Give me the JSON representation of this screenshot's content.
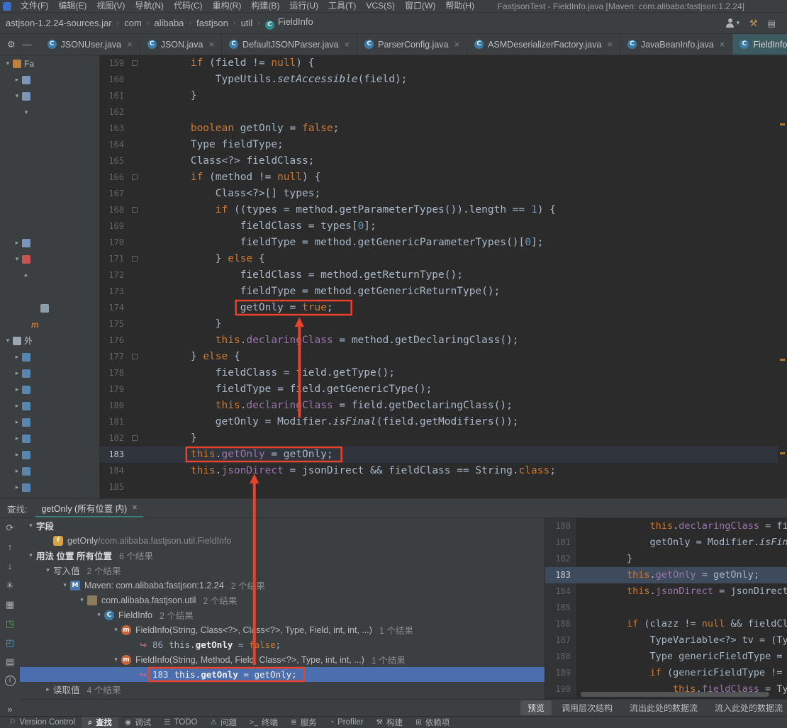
{
  "window_title": "FastjsonTest - FieldInfo.java [Maven: com.alibaba:fastjson:1.2.24]",
  "menu": {
    "items": [
      "文件(F)",
      "编辑(E)",
      "视图(V)",
      "导航(N)",
      "代码(C)",
      "重构(R)",
      "构建(B)",
      "运行(U)",
      "工具(T)",
      "VCS(S)",
      "窗口(W)",
      "帮助(H)"
    ]
  },
  "breadcrumb": {
    "items": [
      "astjson-1.2.24-sources.jar",
      "com",
      "alibaba",
      "fastjson",
      "util"
    ],
    "class_item": "FieldInfo"
  },
  "tabbar_tools": {
    "settings_glyph": "⚙",
    "hide_glyph": "—"
  },
  "editor_tabs": [
    {
      "label": "JSONUser.java",
      "close": true
    },
    {
      "label": "JSON.java",
      "close": true
    },
    {
      "label": "DefaultJSONParser.java",
      "close": true
    },
    {
      "label": "ParserConfig.java",
      "close": true
    },
    {
      "label": "ASMDeserializerFactory.java",
      "close": true
    },
    {
      "label": "JavaBeanInfo.java",
      "close": true
    },
    {
      "label": "FieldInfo",
      "close": false,
      "active": true
    }
  ],
  "project_panel": {
    "rows": [
      {
        "chev": "v",
        "icon": "proj",
        "label": "Fa",
        "ind": 0
      },
      {
        "chev": ">",
        "icon": "folder",
        "ind": 1
      },
      {
        "chev": "v",
        "icon": "folder",
        "ind": 1
      },
      {
        "chev": "v",
        "ind": 2
      },
      {
        "ind": 0
      },
      {
        "ind": 0
      },
      {
        "ind": 0
      },
      {
        "ind": 0
      },
      {
        "ind": 0
      },
      {
        "ind": 0
      },
      {
        "ind": 0
      },
      {
        "chev": ">",
        "icon": "folder",
        "ind": 1
      },
      {
        "chev": "v",
        "icon": "folderRed",
        "ind": 1
      },
      {
        "chev": ">",
        "ind": 2
      },
      {
        "ind": 0
      },
      {
        "icon": "file",
        "ind": 3
      },
      {
        "label": "m",
        "cls": "m",
        "ind": 2
      },
      {
        "chev": "v",
        "icon": "ext",
        "label": "外",
        "ind": 0
      },
      {
        "chev": ">",
        "icon": "lib",
        "ind": 1
      },
      {
        "chev": ">",
        "icon": "lib",
        "ind": 1
      },
      {
        "chev": ">",
        "icon": "lib",
        "ind": 1
      },
      {
        "chev": ">",
        "icon": "lib",
        "ind": 1
      },
      {
        "chev": ">",
        "icon": "lib",
        "ind": 1
      },
      {
        "chev": ">",
        "icon": "lib",
        "ind": 1
      },
      {
        "chev": ">",
        "icon": "lib",
        "ind": 1
      },
      {
        "chev": ">",
        "icon": "lib",
        "ind": 1
      },
      {
        "chev": ">",
        "icon": "lib",
        "ind": 1
      }
    ]
  },
  "editor": {
    "current_line": 183,
    "scroll_marks": [
      96,
      428,
      560,
      634
    ],
    "lines": [
      {
        "n": 159,
        "i": 8,
        "f": true,
        "s": [
          [
            "if",
            "k"
          ],
          [
            " (field != ",
            ""
          ],
          [
            "null",
            "k"
          ],
          [
            ") {",
            ""
          ]
        ]
      },
      {
        "n": 160,
        "i": 12,
        "s": [
          [
            "TypeUtils.",
            ""
          ],
          [
            "setAccessible",
            "s"
          ],
          [
            "(field);",
            ""
          ]
        ]
      },
      {
        "n": 161,
        "i": 8,
        "s": [
          [
            "}",
            ""
          ]
        ]
      },
      {
        "n": 162,
        "i": 0,
        "s": []
      },
      {
        "n": 163,
        "i": 8,
        "s": [
          [
            "boolean",
            "k"
          ],
          [
            " getOnly = ",
            ""
          ],
          [
            "false",
            "k"
          ],
          [
            ";",
            ""
          ]
        ]
      },
      {
        "n": 164,
        "i": 8,
        "s": [
          [
            "Type fieldType;",
            ""
          ]
        ]
      },
      {
        "n": 165,
        "i": 8,
        "s": [
          [
            "Class<?> fieldClass;",
            ""
          ]
        ]
      },
      {
        "n": 166,
        "i": 8,
        "f": true,
        "s": [
          [
            "if",
            "k"
          ],
          [
            " (method != ",
            ""
          ],
          [
            "null",
            "k"
          ],
          [
            ") {",
            ""
          ]
        ]
      },
      {
        "n": 167,
        "i": 12,
        "s": [
          [
            "Class<?>[] types;",
            ""
          ]
        ]
      },
      {
        "n": 168,
        "i": 12,
        "f": true,
        "s": [
          [
            "if",
            "k"
          ],
          [
            " ((types = method.getParameterTypes()).length == ",
            ""
          ],
          [
            "1",
            "n"
          ],
          [
            ") {",
            ""
          ]
        ]
      },
      {
        "n": 169,
        "i": 16,
        "s": [
          [
            "fieldClass = types[",
            ""
          ],
          [
            "0",
            "n"
          ],
          [
            "];",
            ""
          ]
        ]
      },
      {
        "n": 170,
        "i": 16,
        "s": [
          [
            "fieldType = method.getGenericParameterTypes()[",
            ""
          ],
          [
            "0",
            "n"
          ],
          [
            "];",
            ""
          ]
        ]
      },
      {
        "n": 171,
        "i": 12,
        "f": true,
        "s": [
          [
            "} ",
            ""
          ],
          [
            "else",
            "k"
          ],
          [
            " {",
            ""
          ]
        ]
      },
      {
        "n": 172,
        "i": 16,
        "s": [
          [
            "fieldClass = method.getReturnType();",
            ""
          ]
        ]
      },
      {
        "n": 173,
        "i": 16,
        "s": [
          [
            "fieldType = method.getGenericReturnType();",
            ""
          ]
        ]
      },
      {
        "n": 174,
        "i": 16,
        "hl": "hl-174",
        "s": [
          [
            "getOnly = ",
            ""
          ],
          [
            "true",
            "k"
          ],
          [
            ";",
            ""
          ]
        ]
      },
      {
        "n": 175,
        "i": 12,
        "s": [
          [
            "}",
            ""
          ]
        ]
      },
      {
        "n": 176,
        "i": 12,
        "s": [
          [
            "this",
            "k"
          ],
          [
            ".",
            ""
          ],
          [
            "declaringClass",
            "f2"
          ],
          [
            " = method.getDeclaringClass();",
            ""
          ]
        ]
      },
      {
        "n": 177,
        "i": 8,
        "f": true,
        "s": [
          [
            "} ",
            ""
          ],
          [
            "else",
            "k"
          ],
          [
            " {",
            ""
          ]
        ]
      },
      {
        "n": 178,
        "i": 12,
        "s": [
          [
            "fieldClass = field.getType();",
            ""
          ]
        ]
      },
      {
        "n": 179,
        "i": 12,
        "s": [
          [
            "fieldType = field.getGenericType();",
            ""
          ]
        ]
      },
      {
        "n": 180,
        "i": 12,
        "s": [
          [
            "this",
            "k"
          ],
          [
            ".",
            ""
          ],
          [
            "declaringClass",
            "f2"
          ],
          [
            " = field.getDeclaringClass();",
            ""
          ]
        ]
      },
      {
        "n": 181,
        "i": 12,
        "s": [
          [
            "getOnly = Modifier.",
            ""
          ],
          [
            "isFinal",
            "s"
          ],
          [
            "(field.getModifiers());",
            ""
          ]
        ]
      },
      {
        "n": 182,
        "i": 8,
        "f": true,
        "s": [
          [
            "}",
            ""
          ]
        ]
      },
      {
        "n": 183,
        "i": 8,
        "cur": true,
        "hl": "hl-183",
        "s": [
          [
            "this",
            "k"
          ],
          [
            ".",
            ""
          ],
          [
            "getOnly",
            "f2"
          ],
          [
            " = getOnly;",
            ""
          ]
        ]
      },
      {
        "n": 184,
        "i": 8,
        "s": [
          [
            "this",
            "k"
          ],
          [
            ".",
            ""
          ],
          [
            "jsonDirect",
            "f2"
          ],
          [
            " = jsonDirect && fieldClass == String.",
            ""
          ],
          [
            "class",
            "k"
          ],
          [
            ";",
            ""
          ]
        ]
      },
      {
        "n": 185,
        "i": 0,
        "s": []
      }
    ]
  },
  "find_panel": {
    "label": "查找:",
    "tab": {
      "title": "getOnly (所有位置 内)",
      "close": "×"
    },
    "toolbar": [
      {
        "name": "rerun-search-icon",
        "g": "⟳"
      },
      {
        "name": "previous-occurrence-icon",
        "g": "↑"
      },
      {
        "name": "next-occurrence-icon",
        "g": "↓"
      },
      {
        "name": "pin-tab-icon",
        "g": "✳"
      },
      {
        "name": "group-options-icon",
        "g": "▦"
      },
      {
        "name": "open-in-editor-icon",
        "g": "◳",
        "c": "#6A9E6E"
      },
      {
        "name": "open-results-in-new-tab-icon",
        "g": "◰",
        "c": "#5D9CBF"
      },
      {
        "name": "preview-usages-icon",
        "g": "▤"
      },
      {
        "name": "info-icon",
        "g": "i",
        "circle": true
      }
    ],
    "more_glyph": "»",
    "tree": [
      {
        "ind": 0,
        "chev": "v",
        "head": true,
        "text": "字段"
      },
      {
        "ind": 1,
        "icon": "field",
        "text": "getOnly",
        "dim": " /com.alibaba.fastjson.util.FieldInfo"
      },
      {
        "ind": 0,
        "chev": "v",
        "head": true,
        "text": "用法 位置 所有位置",
        "count": "6 个结果"
      },
      {
        "ind": 1,
        "chev": "v",
        "text": "写入值",
        "count": "2 个结果"
      },
      {
        "ind": 2,
        "chev": "v",
        "icon": "maven",
        "text": "Maven: com.alibaba:fastjson:1.2.24",
        "count": "2 个结果"
      },
      {
        "ind": 3,
        "chev": "v",
        "icon": "package",
        "text": "com.alibaba.fastjson.util",
        "count": "2 个结果"
      },
      {
        "ind": 4,
        "chev": "v",
        "icon": "class",
        "text": "FieldInfo",
        "count": "2 个结果"
      },
      {
        "ind": 5,
        "chev": "v",
        "icon": "method",
        "text": "FieldInfo(String, Class<?>, Class<?>, Type, Field, int, int, ...)",
        "count": "1 个结果"
      },
      {
        "ind": 6,
        "icon": "usage",
        "lineno": "86",
        "segs": [
          [
            "this.",
            ""
          ],
          [
            "getOnly",
            "b"
          ],
          [
            " = ",
            ""
          ],
          [
            "false",
            "k"
          ],
          [
            ";",
            ""
          ]
        ]
      },
      {
        "ind": 5,
        "chev": "v",
        "icon": "method",
        "text": "FieldInfo(String, Method, Field, Class<?>, Type, int, int, ...)",
        "count": "1 个结果"
      },
      {
        "ind": 6,
        "icon": "usage",
        "lineno": "183",
        "segs": [
          [
            "this.",
            "w"
          ],
          [
            "getOnly",
            "b"
          ],
          [
            " = getOnly;",
            "w"
          ]
        ],
        "sel": true,
        "boxed": true
      },
      {
        "ind": 1,
        "chev": ">",
        "text": "读取值",
        "count": "4 个结果"
      }
    ],
    "preview": {
      "current_line": 183,
      "lines": [
        {
          "n": 180,
          "i": 12,
          "s": [
            [
              "this",
              "k"
            ],
            [
              ".",
              ""
            ],
            [
              "declaringClass",
              "f2"
            ],
            [
              " = field.",
              ""
            ]
          ]
        },
        {
          "n": 181,
          "i": 12,
          "s": [
            [
              "getOnly = Modifier.",
              ""
            ],
            [
              "isFinal",
              "s"
            ],
            [
              "(f",
              ""
            ]
          ]
        },
        {
          "n": 182,
          "i": 8,
          "s": [
            [
              "}",
              ""
            ]
          ]
        },
        {
          "n": 183,
          "i": 8,
          "cur": true,
          "s": [
            [
              "this",
              "k"
            ],
            [
              ".",
              ""
            ],
            [
              "getOnly",
              "f2"
            ],
            [
              " = getOnly;",
              ""
            ]
          ]
        },
        {
          "n": 184,
          "i": 8,
          "s": [
            [
              "this",
              "k"
            ],
            [
              ".",
              ""
            ],
            [
              "jsonDirect",
              "f2"
            ],
            [
              " = jsonDirect && ",
              ""
            ]
          ]
        },
        {
          "n": 185,
          "i": 0,
          "s": []
        },
        {
          "n": 186,
          "i": 8,
          "s": [
            [
              "if",
              "k"
            ],
            [
              " (clazz != ",
              ""
            ],
            [
              "null",
              "k"
            ],
            [
              " && fieldClass ",
              ""
            ]
          ]
        },
        {
          "n": 187,
          "i": 12,
          "s": [
            [
              "TypeVariable<?> tv = (TypeVa",
              ""
            ]
          ]
        },
        {
          "n": 188,
          "i": 12,
          "s": [
            [
              "Type genericFieldType = getI",
              ""
            ]
          ]
        },
        {
          "n": 189,
          "i": 12,
          "s": [
            [
              "if",
              "k"
            ],
            [
              " (genericFieldType != ",
              ""
            ],
            [
              "null",
              "k"
            ]
          ]
        },
        {
          "n": 190,
          "i": 16,
          "s": [
            [
              "this",
              "k"
            ],
            [
              ".",
              ""
            ],
            [
              "fieldClass",
              "f2"
            ],
            [
              " = TypeUt",
              ""
            ]
          ]
        }
      ],
      "tabs": [
        {
          "label": "预览",
          "active": true
        },
        {
          "label": "调用层次结构"
        },
        {
          "label": "流出此处的数据流"
        },
        {
          "label": "流入此处的数据流"
        }
      ]
    }
  },
  "status_bar": {
    "items": [
      {
        "label": "Version Control",
        "glyph": "⚐"
      },
      {
        "label": "查找",
        "glyph": "⌕",
        "active": true
      },
      {
        "label": "调试",
        "glyph": "◉"
      },
      {
        "label": "TODO",
        "glyph": "☰"
      },
      {
        "label": "问题",
        "glyph": "⚠"
      },
      {
        "label": "终端",
        "glyph": ">_"
      },
      {
        "label": "服务",
        "glyph": "≣"
      },
      {
        "label": "Profiler",
        "glyph": "◔"
      },
      {
        "label": "构建",
        "glyph": "⚒"
      },
      {
        "label": "依赖项",
        "glyph": "⊞"
      }
    ]
  },
  "annotations": {
    "color": "#E8412C",
    "boxes": [
      {
        "target": "hl-174",
        "pad_l": 6,
        "pad_r": 26
      },
      {
        "target": "hl-183",
        "pad_l": 6,
        "pad_r": 12
      },
      {
        "target": "hl-find",
        "pad_l": 5,
        "pad_r": 10
      }
    ],
    "arrows": [
      {
        "type": "up-to-box",
        "target": "hl-174",
        "length": 145
      },
      {
        "type": "between",
        "from": "hl-find",
        "to": "hl-183"
      }
    ]
  }
}
